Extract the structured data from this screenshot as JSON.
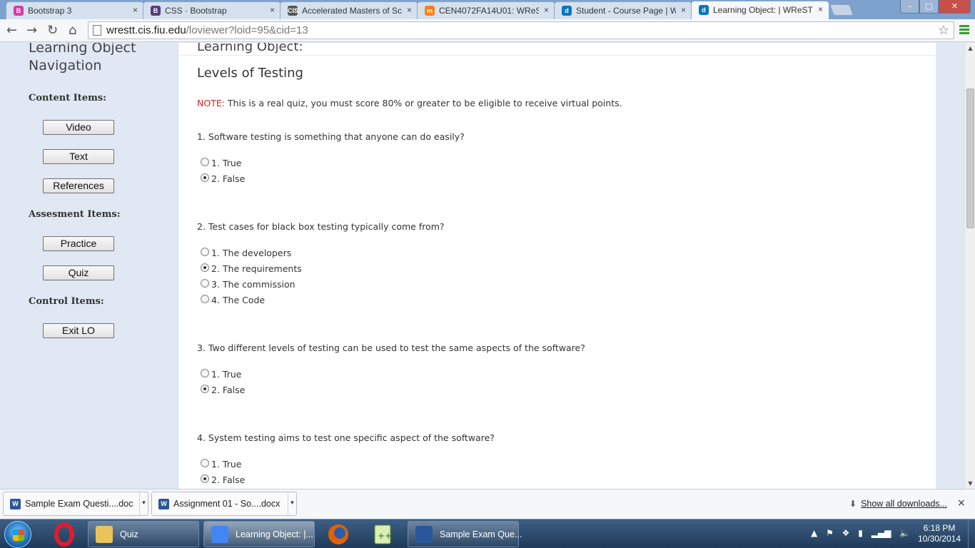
{
  "browser": {
    "tabs": [
      {
        "title": "Bootstrap 3",
        "icon": "bootstrap3-favicon",
        "color": "#d63aa8",
        "glyph": "B"
      },
      {
        "title": "CSS · Bootstrap",
        "icon": "bootstrap-favicon",
        "color": "#563d7c",
        "glyph": "B"
      },
      {
        "title": "Accelerated Masters of Sci",
        "icon": "cis-favicon",
        "color": "#555555",
        "glyph": "CIS"
      },
      {
        "title": "CEN4072FA14U01: WReST",
        "icon": "moodle-favicon",
        "color": "#f98012",
        "glyph": "m"
      },
      {
        "title": "Student - Course Page | W",
        "icon": "drupal-favicon",
        "color": "#0678be",
        "glyph": "d"
      },
      {
        "title": "Learning Object: | WReST",
        "icon": "drupal-favicon",
        "color": "#0678be",
        "glyph": "d"
      }
    ],
    "tab_close": "×",
    "url_host": "wrestt.cis.fiu.edu",
    "url_path": "/loviewer?loid=95&cid=13"
  },
  "sidebar": {
    "title_line1": "Learning Object",
    "title_line2": "Navigation",
    "content_heading": "Content Items:",
    "content_buttons": [
      "Video",
      "Text",
      "References"
    ],
    "assessment_heading": "Assesment Items:",
    "assessment_buttons": [
      "Practice",
      "Quiz"
    ],
    "control_heading": "Control Items:",
    "control_buttons": [
      "Exit LO"
    ]
  },
  "main": {
    "header": "Learning Object:",
    "title": "Levels of Testing",
    "note_label": "NOTE:",
    "note_text": " This is a real quiz, you must score 80% or greater to be eligible to receive virtual points.",
    "questions": [
      {
        "text": "1. Software testing is something that anyone can do easily?",
        "options": [
          "1. True",
          "2. False"
        ],
        "selected": 1
      },
      {
        "text": "2. Test cases for black box testing typically come from?",
        "options": [
          "1. The developers",
          "2. The requirements",
          "3. The commission",
          "4. The Code"
        ],
        "selected": 1
      },
      {
        "text": "3. Two different levels of testing can be used to test the same aspects of the software?",
        "options": [
          "1. True",
          "2. False"
        ],
        "selected": 1
      },
      {
        "text": "4. System testing aims to test one specific aspect of the software?",
        "options": [
          "1. True",
          "2. False"
        ],
        "selected": 1
      }
    ]
  },
  "downloads": {
    "items": [
      "Sample Exam Questi....doc",
      "Assignment 01 - So....docx"
    ],
    "show_all": "Show all downloads...",
    "close": "×"
  },
  "taskbar": {
    "buttons": [
      {
        "label": "Quiz",
        "icon": "folder-icon",
        "color": "#e8c45a"
      },
      {
        "label": "Learning Object: |...",
        "icon": "chrome-icon",
        "color": "#4285f4"
      },
      {
        "label": "Sample Exam Que...",
        "icon": "word-icon",
        "color": "#2b579a"
      }
    ],
    "time": "6:18 PM",
    "date": "10/30/2014"
  }
}
